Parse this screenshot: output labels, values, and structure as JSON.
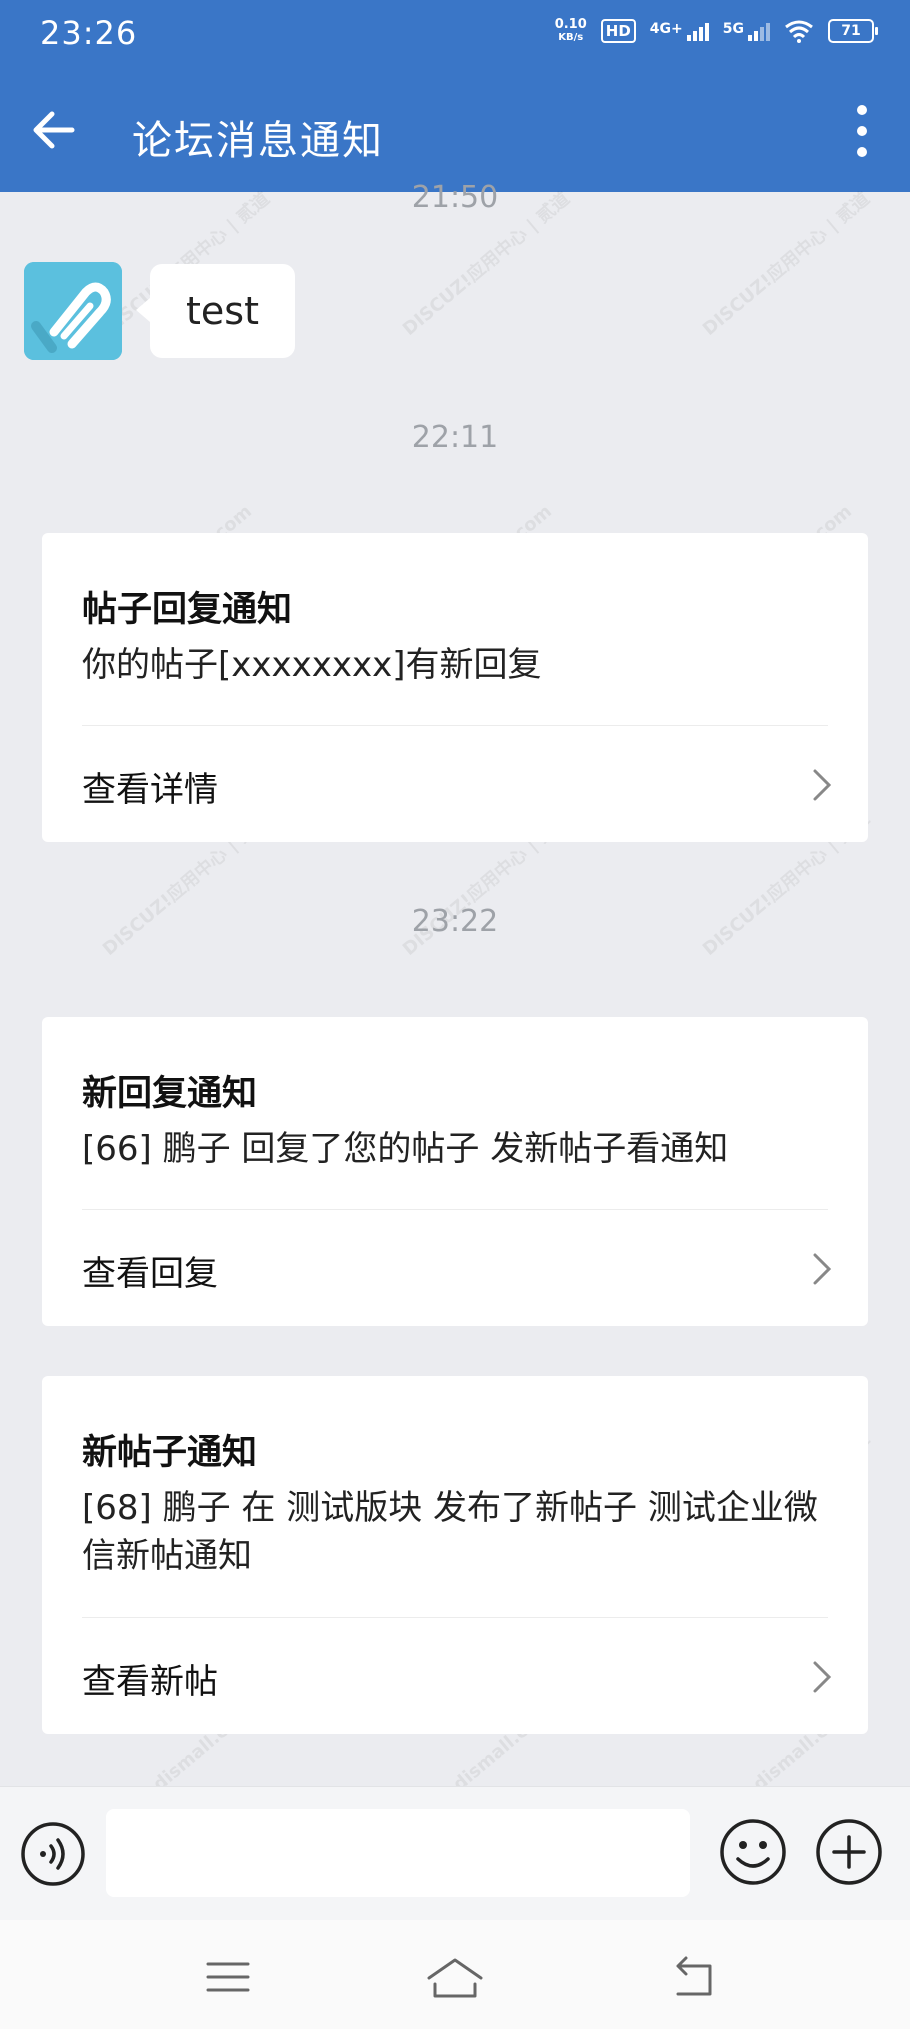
{
  "status_bar": {
    "time": "23:26",
    "net_speed_value": "0.10",
    "net_speed_unit": "KB/s",
    "hd_label": "HD",
    "sim1_label": "4G+",
    "sim2_label": "5G",
    "battery": "71"
  },
  "header": {
    "title": "论坛消息通知",
    "back_icon": "arrow-left-icon",
    "menu_icon": "more-vertical-icon"
  },
  "messages": {
    "timestamp_top": "21:50",
    "test_message": "test",
    "timestamp_1": "22:11",
    "timestamp_2": "23:22"
  },
  "cards": [
    {
      "title": "帖子回复通知",
      "body": "你的帖子[xxxxxxxx]有新回复",
      "link_label": "查看详情"
    },
    {
      "title": "新回复通知",
      "body": "[66] 鹏子 回复了您的帖子 发新帖子看通知",
      "link_label": "查看回复"
    },
    {
      "title": "新帖子通知",
      "body": "[68] 鹏子 在 测试版块 发布了新帖子 测试企业微信新帖通知",
      "link_label": "查看新帖"
    }
  ],
  "watermark": {
    "brand": "DISCUZ!应用中心 | 贰道",
    "url": "addon.dismall.com"
  },
  "input_bar": {
    "placeholder": "",
    "voice_icon": "voice-icon",
    "emoji_icon": "emoji-icon",
    "plus_icon": "plus-icon"
  },
  "colors": {
    "accent": "#3a76c7",
    "background": "#ebecf0",
    "avatar": "#5bc0de"
  }
}
